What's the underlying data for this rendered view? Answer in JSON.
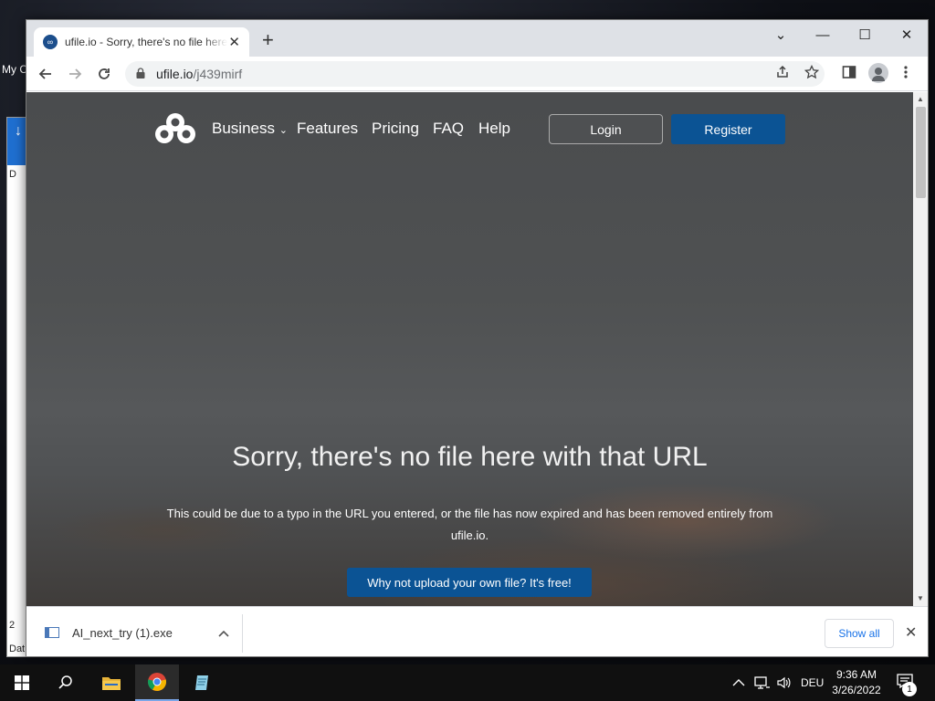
{
  "desktop": {
    "label": "My C",
    "behind_window_texts": [
      "D",
      "2",
      "Dat"
    ]
  },
  "browser": {
    "tab": {
      "title": "ufile.io - Sorry, there's no file here with that URL",
      "close_label": "✕"
    },
    "new_tab_label": "+",
    "window_controls": {
      "tab_search": "⌄",
      "minimize": "—",
      "maximize": "☐",
      "close": "✕"
    },
    "address": {
      "host": "ufile.io",
      "path": "/j439mirf"
    }
  },
  "page": {
    "nav": {
      "business": "Business",
      "features": "Features",
      "pricing": "Pricing",
      "faq": "FAQ",
      "help": "Help",
      "login": "Login",
      "register": "Register"
    },
    "headline": "Sorry, there's no file here with that URL",
    "subtext": "This could be due to a typo in the URL you entered, or the file has now expired and has been removed entirely from ufile.io.",
    "cta": "Why not upload your own file? It's free!"
  },
  "downloads": {
    "filename": "AI_next_try (1).exe",
    "show_all": "Show all"
  },
  "taskbar": {
    "language": "DEU",
    "time": "9:36 AM",
    "date": "3/26/2022",
    "notification_count": "1"
  },
  "colors": {
    "brand_blue": "#0b5394",
    "link_blue": "#1a73e8"
  }
}
